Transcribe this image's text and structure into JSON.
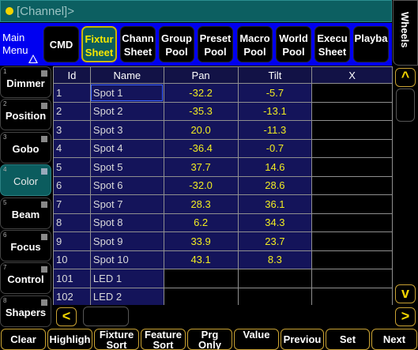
{
  "window": {
    "title": "[Channel]>"
  },
  "menu": {
    "main_label": "Main\nMenu",
    "buttons": [
      {
        "label": "CMD",
        "active": false
      },
      {
        "label": "Fixtur\nSheet",
        "active": true
      },
      {
        "label": "Chann\nSheet",
        "active": false
      },
      {
        "label": "Group\nPool",
        "active": false
      },
      {
        "label": "Preset\nPool",
        "active": false
      },
      {
        "label": "Macro\nPool",
        "active": false
      },
      {
        "label": "World\nPool",
        "active": false
      },
      {
        "label": "Execu\nSheet",
        "active": false
      },
      {
        "label": "Playba",
        "active": false
      }
    ],
    "wheels_label": "Wheels"
  },
  "presets": [
    {
      "num": "1",
      "label": "Dimmer",
      "selected": false
    },
    {
      "num": "2",
      "label": "Position",
      "selected": false
    },
    {
      "num": "3",
      "label": "Gobo",
      "selected": false
    },
    {
      "num": "4",
      "label": "Color",
      "selected": true
    },
    {
      "num": "5",
      "label": "Beam",
      "selected": false
    },
    {
      "num": "6",
      "label": "Focus",
      "selected": false
    },
    {
      "num": "7",
      "label": "Control",
      "selected": false
    },
    {
      "num": "8",
      "label": "Shapers",
      "selected": false
    }
  ],
  "sheet": {
    "columns": [
      "Id",
      "Name",
      "Pan",
      "Tilt",
      "X"
    ],
    "rows": [
      {
        "id": "1",
        "name": "Spot 1",
        "pan": "-32.2",
        "tilt": "-5.7"
      },
      {
        "id": "2",
        "name": "Spot 2",
        "pan": "-35.3",
        "tilt": "-13.1"
      },
      {
        "id": "3",
        "name": "Spot 3",
        "pan": "20.0",
        "tilt": "-11.3"
      },
      {
        "id": "4",
        "name": "Spot 4",
        "pan": "-36.4",
        "tilt": "-0.7"
      },
      {
        "id": "5",
        "name": "Spot 5",
        "pan": "37.7",
        "tilt": "14.6"
      },
      {
        "id": "6",
        "name": "Spot 6",
        "pan": "-32.0",
        "tilt": "28.6"
      },
      {
        "id": "7",
        "name": "Spot 7",
        "pan": "28.3",
        "tilt": "36.1"
      },
      {
        "id": "8",
        "name": "Spot 8",
        "pan": "6.2",
        "tilt": "34.3"
      },
      {
        "id": "9",
        "name": "Spot 9",
        "pan": "33.9",
        "tilt": "23.7"
      },
      {
        "id": "10",
        "name": "Spot 10",
        "pan": "43.1",
        "tilt": "8.3"
      },
      {
        "id": "101",
        "name": "LED 1",
        "pan": "",
        "tilt": ""
      },
      {
        "id": "102",
        "name": "LED 2",
        "pan": "",
        "tilt": ""
      }
    ]
  },
  "scroll": {
    "up": "^",
    "down": "v",
    "left": "<",
    "right": ">"
  },
  "functions": [
    "Clear",
    "Highligh",
    "Fixture\nSort",
    "Feature\nSort",
    "Prg\nOnly",
    "Value\n",
    "Previou",
    "Set",
    "Next"
  ],
  "colors": {
    "accent_yellow": "#f2d400",
    "menubar_blue": "#0000f0",
    "selected_teal": "#0b5c5e"
  }
}
